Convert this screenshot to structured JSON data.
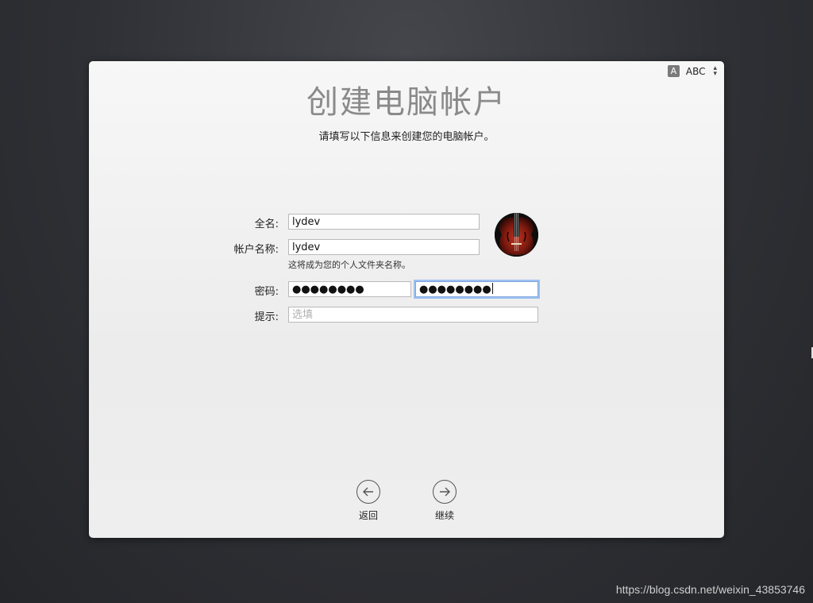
{
  "window": {
    "title": "创建电脑帐户",
    "subtitle": "请填写以下信息来创建您的电脑帐户。"
  },
  "input_source": {
    "badge": "A",
    "label": "ABC"
  },
  "form": {
    "full_name_label": "全名:",
    "full_name_value": "lydev",
    "account_name_label": "帐户名称:",
    "account_name_value": "lydev",
    "account_hint": "这将成为您的个人文件夹名称。",
    "password_label": "密码:",
    "password_value": "●●●●●●●●",
    "verify_value": "●●●●●●●●",
    "hint_label": "提示:",
    "hint_placeholder": "选填"
  },
  "nav": {
    "back_label": "返回",
    "continue_label": "继续"
  },
  "watermark": "https://blog.csdn.net/weixin_43853746"
}
